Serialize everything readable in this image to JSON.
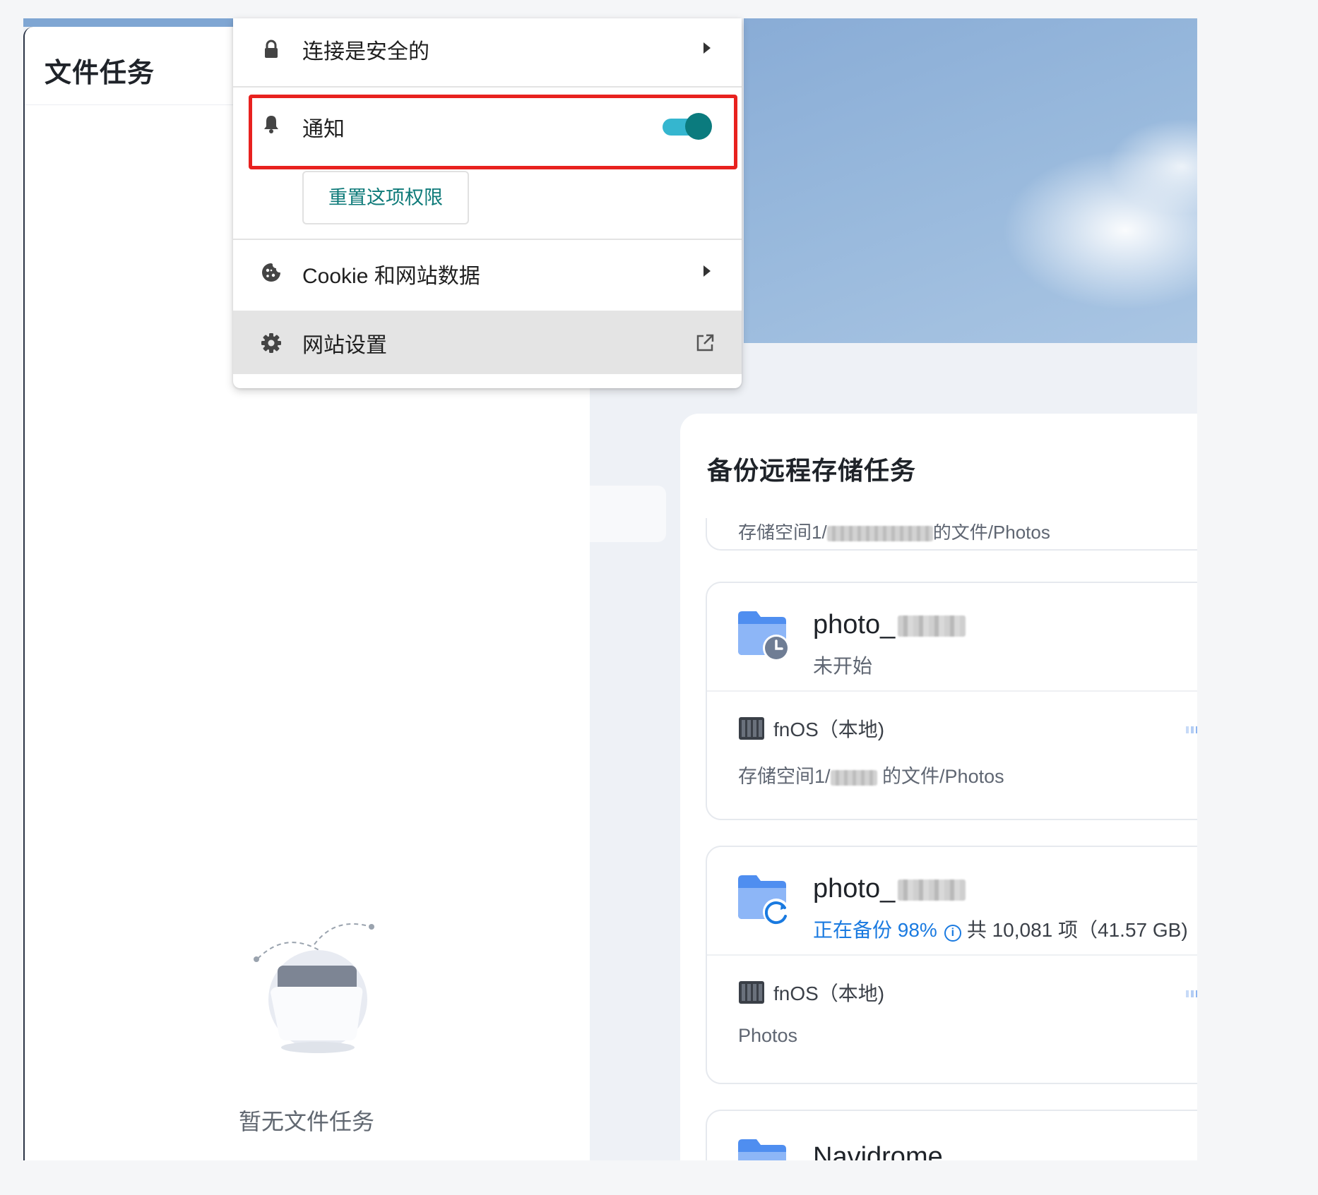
{
  "file_tasks": {
    "title": "文件任务",
    "empty_text": "暂无文件任务"
  },
  "site_info_popup": {
    "connection_label": "连接是安全的",
    "notifications_label": "通知",
    "notifications_enabled": true,
    "reset_permission_label": "重置这项权限",
    "cookie_label": "Cookie 和网站数据",
    "site_settings_label": "网站设置"
  },
  "backup": {
    "title": "备份远程存储任务",
    "partial_path": "存储空间1/",
    "partial_path_suffix": "的文件/Photos",
    "tasks": [
      {
        "name": "photo_",
        "status": "未开始",
        "server": "fnOS（本地)",
        "path_prefix": "存储空间1/",
        "path_suffix": "的文件/Photos"
      },
      {
        "name": "photo_",
        "status": "正在备份 98%",
        "status_total": "共 10,081 项（41.57 GB)",
        "server": "fnOS（本地)",
        "path": "Photos"
      },
      {
        "name": "Navidrome"
      }
    ]
  },
  "colors": {
    "toggle_track": "#35b6cf",
    "toggle_knob": "#0b7b7e",
    "highlight_border": "#e8211f",
    "link_teal": "#0e7a79",
    "active_blue": "#1a7ae0"
  },
  "icons": [
    "lock-icon",
    "bell-icon",
    "cookie-icon",
    "gear-icon",
    "external-link-icon",
    "folder-clock-icon",
    "folder-sync-icon",
    "folder-check-icon",
    "server-icon",
    "arrow-right-icon",
    "info-icon",
    "empty-folder-illustration"
  ]
}
